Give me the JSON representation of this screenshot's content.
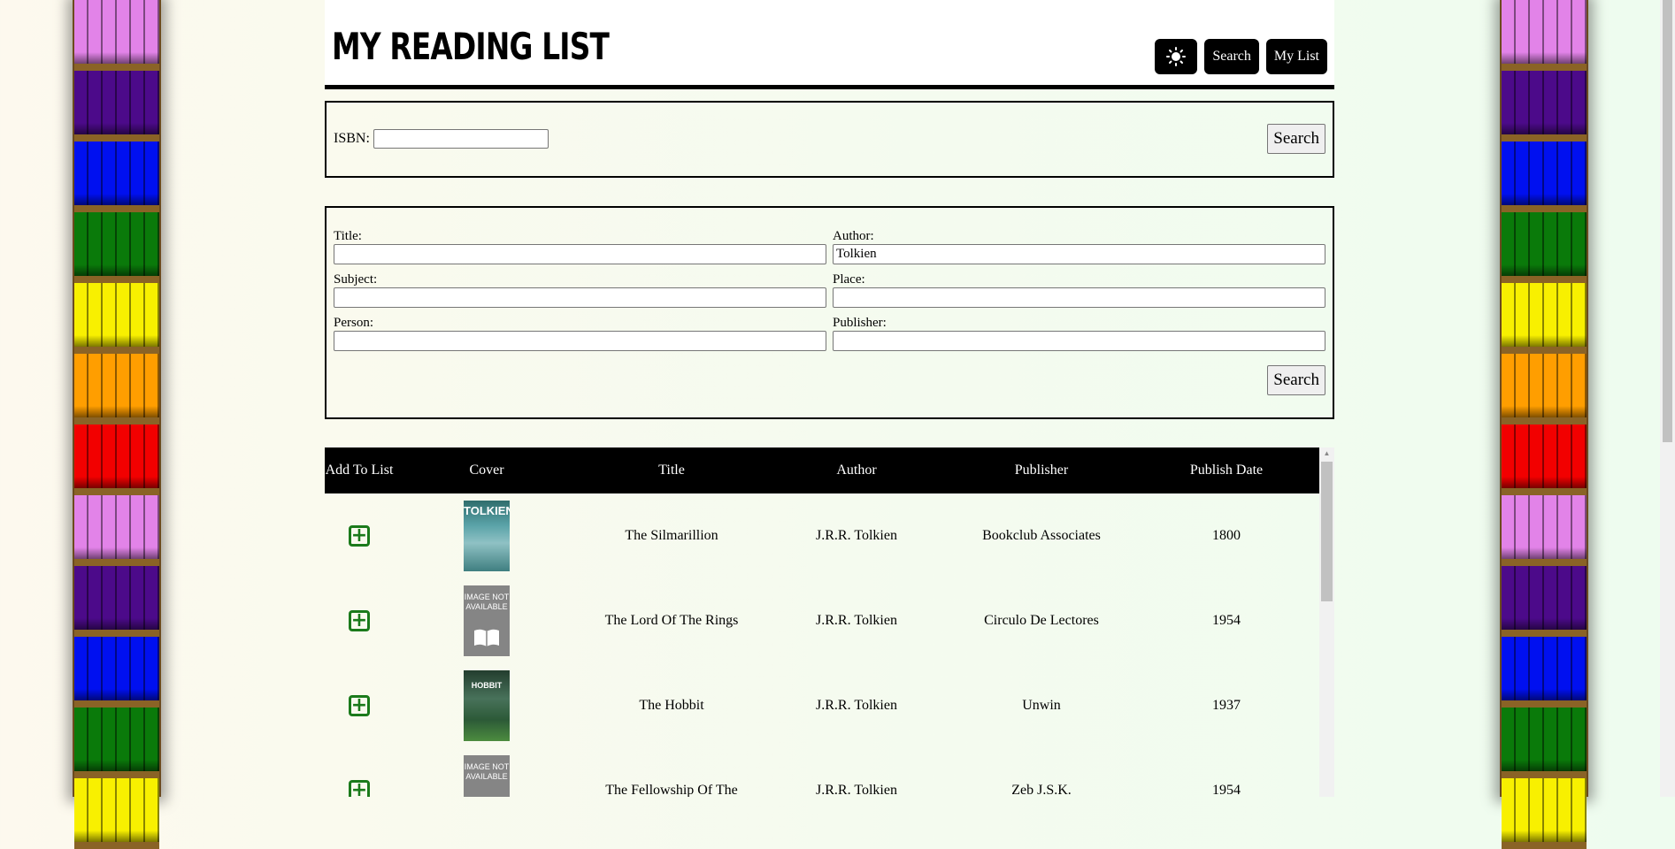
{
  "site": {
    "title": "My Reading List"
  },
  "nav": {
    "theme_icon": "sun-icon",
    "search": "Search",
    "my_list": "My List"
  },
  "isbn_search": {
    "label": "ISBN:",
    "value": "",
    "button": "Search"
  },
  "advanced_search": {
    "title_label": "Title:",
    "title_value": "",
    "author_label": "Author:",
    "author_value": "Tolkien",
    "subject_label": "Subject:",
    "subject_value": "",
    "place_label": "Place:",
    "place_value": "",
    "person_label": "Person:",
    "person_value": "",
    "publisher_label": "Publisher:",
    "publisher_value": "",
    "button": "Search"
  },
  "results": {
    "headers": {
      "add": "Add To List",
      "cover": "Cover",
      "title": "Title",
      "author": "Author",
      "publisher": "Publisher",
      "date": "Publish Date"
    },
    "image_na": "IMAGE NOT AVAILABLE",
    "rows": [
      {
        "title": "The Silmarillion",
        "author": "J.R.R. Tolkien",
        "publisher": "Bookclub Associates",
        "date": "1800",
        "cover": "silmarillion-cover",
        "cover_text": "TOLKIEN"
      },
      {
        "title": "The Lord Of The Rings",
        "author": "J.R.R. Tolkien",
        "publisher": "Circulo De Lectores",
        "date": "1954",
        "cover": "image-not-available"
      },
      {
        "title": "The Hobbit",
        "author": "J.R.R. Tolkien",
        "publisher": "Unwin",
        "date": "1937",
        "cover": "hobbit-cover",
        "cover_text": "HOBBIT"
      },
      {
        "title": "The Fellowship Of The",
        "author": "J.R.R. Tolkien",
        "publisher": "Zeb J.S.K.",
        "date": "1954",
        "cover": "image-not-available"
      }
    ]
  },
  "colors": {
    "accent_add": "#1b7a1b",
    "header_bg": "#000000",
    "shelf_wood": "#6b4a1e"
  },
  "shelf_colors": [
    "#e283e8",
    "#4c0a8a",
    "#0010f0",
    "#0a7a0a",
    "#f8f000",
    "#ff9e00",
    "#f20000",
    "#e283e8",
    "#4c0a8a",
    "#0010f0",
    "#0a7a0a",
    "#f8f000"
  ]
}
